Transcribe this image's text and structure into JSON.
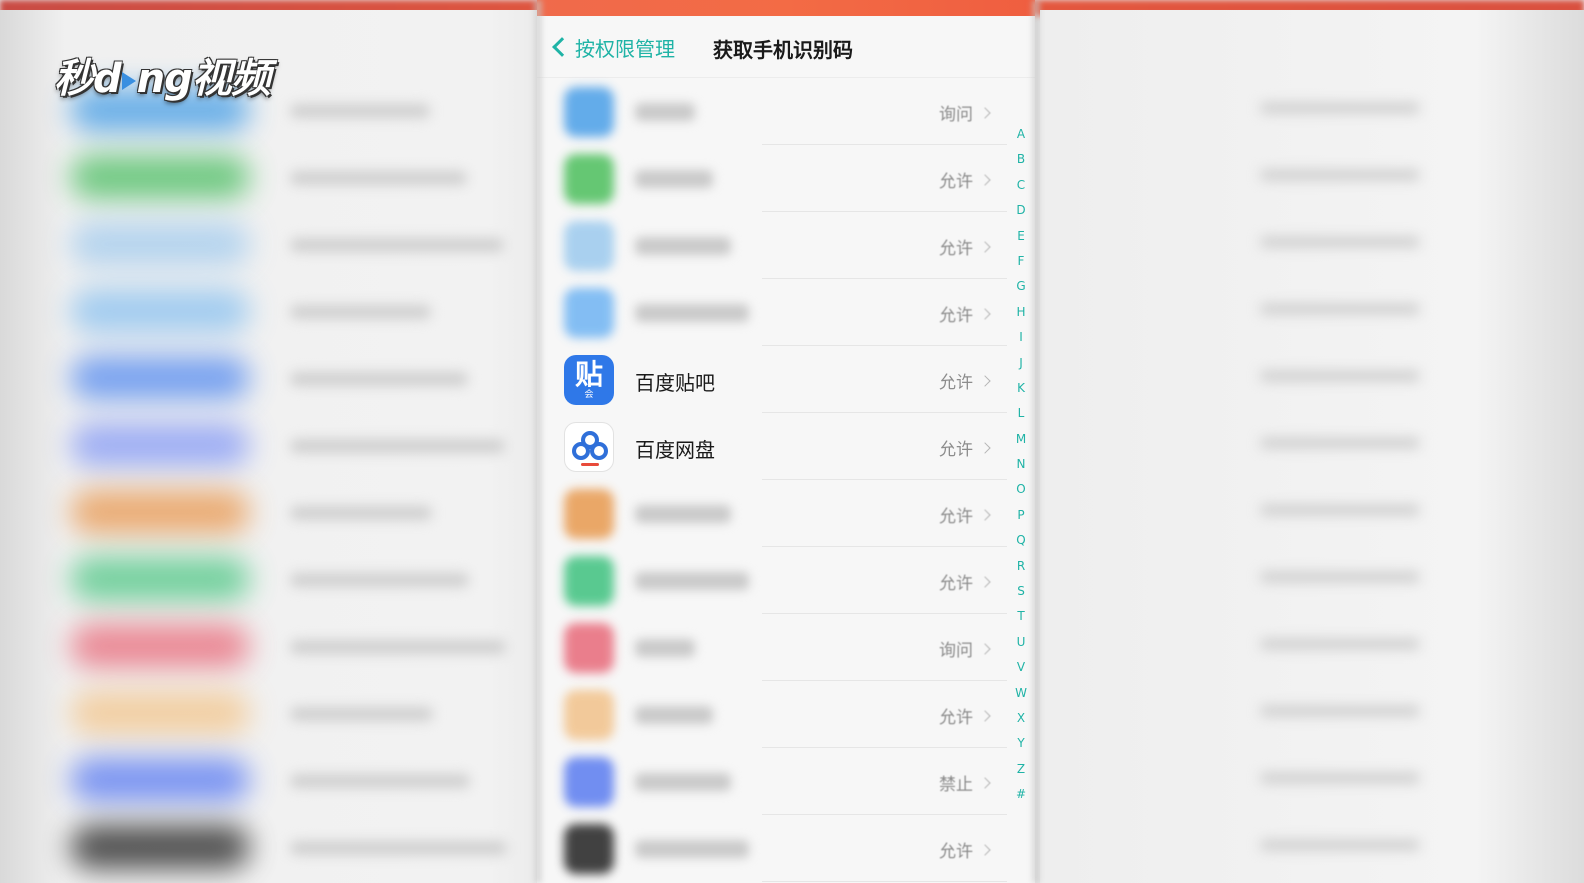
{
  "watermark": {
    "text": "秒dong视频"
  },
  "header": {
    "back_label": "按权限管理",
    "title": "获取手机识别码"
  },
  "apps": [
    {
      "name": "",
      "permission": "询问",
      "icon": "app-icon-blue",
      "color": "#4a9fe8",
      "blurred": true
    },
    {
      "name": "",
      "permission": "允许",
      "icon": "app-icon-green",
      "color": "#4cbf5c",
      "blurred": true
    },
    {
      "name": "",
      "permission": "允许",
      "icon": "app-icon-lightblue",
      "color": "#9ccaee",
      "blurred": true
    },
    {
      "name": "",
      "permission": "允许",
      "icon": "app-icon-sky",
      "color": "#6fb4f3",
      "blurred": true
    },
    {
      "name": "百度贴吧",
      "permission": "允许",
      "icon": "tieba-icon",
      "color": "#2f78e8",
      "blurred": false
    },
    {
      "name": "百度网盘",
      "permission": "允许",
      "icon": "baidu-netdisk-icon",
      "color": "#2f6fd9",
      "blurred": false
    },
    {
      "name": "",
      "permission": "允许",
      "icon": "app-icon-orange",
      "color": "#e89a4f",
      "blurred": true
    },
    {
      "name": "",
      "permission": "允许",
      "icon": "app-icon-teal",
      "color": "#3ec27f",
      "blurred": true
    },
    {
      "name": "",
      "permission": "询问",
      "icon": "app-icon-pink",
      "color": "#e86a7a",
      "blurred": true
    },
    {
      "name": "",
      "permission": "允许",
      "icon": "app-icon-amber",
      "color": "#f2c28a",
      "blurred": true
    },
    {
      "name": "",
      "permission": "禁止",
      "icon": "app-icon-indigo",
      "color": "#5a7cf0",
      "blurred": true
    },
    {
      "name": "",
      "permission": "允许",
      "icon": "app-icon-black",
      "color": "#222222",
      "blurred": true
    }
  ],
  "alphabet_index": [
    "A",
    "B",
    "C",
    "D",
    "E",
    "F",
    "G",
    "H",
    "I",
    "J",
    "K",
    "L",
    "M",
    "N",
    "O",
    "P",
    "Q",
    "R",
    "S",
    "T",
    "U",
    "V",
    "W",
    "X",
    "Y",
    "Z",
    "#"
  ],
  "background_blobs": [
    "#4aa0e6",
    "#52c068",
    "#a6cdee",
    "#8ec3f0",
    "#5b8ff0",
    "#8a9ef5",
    "#e99b55",
    "#56c98a",
    "#e9707f",
    "#f3c790",
    "#5f7ff2",
    "#2a2a2a"
  ],
  "colors": {
    "accent": "#1fb3a6",
    "status_bar": "#f06a4b"
  }
}
